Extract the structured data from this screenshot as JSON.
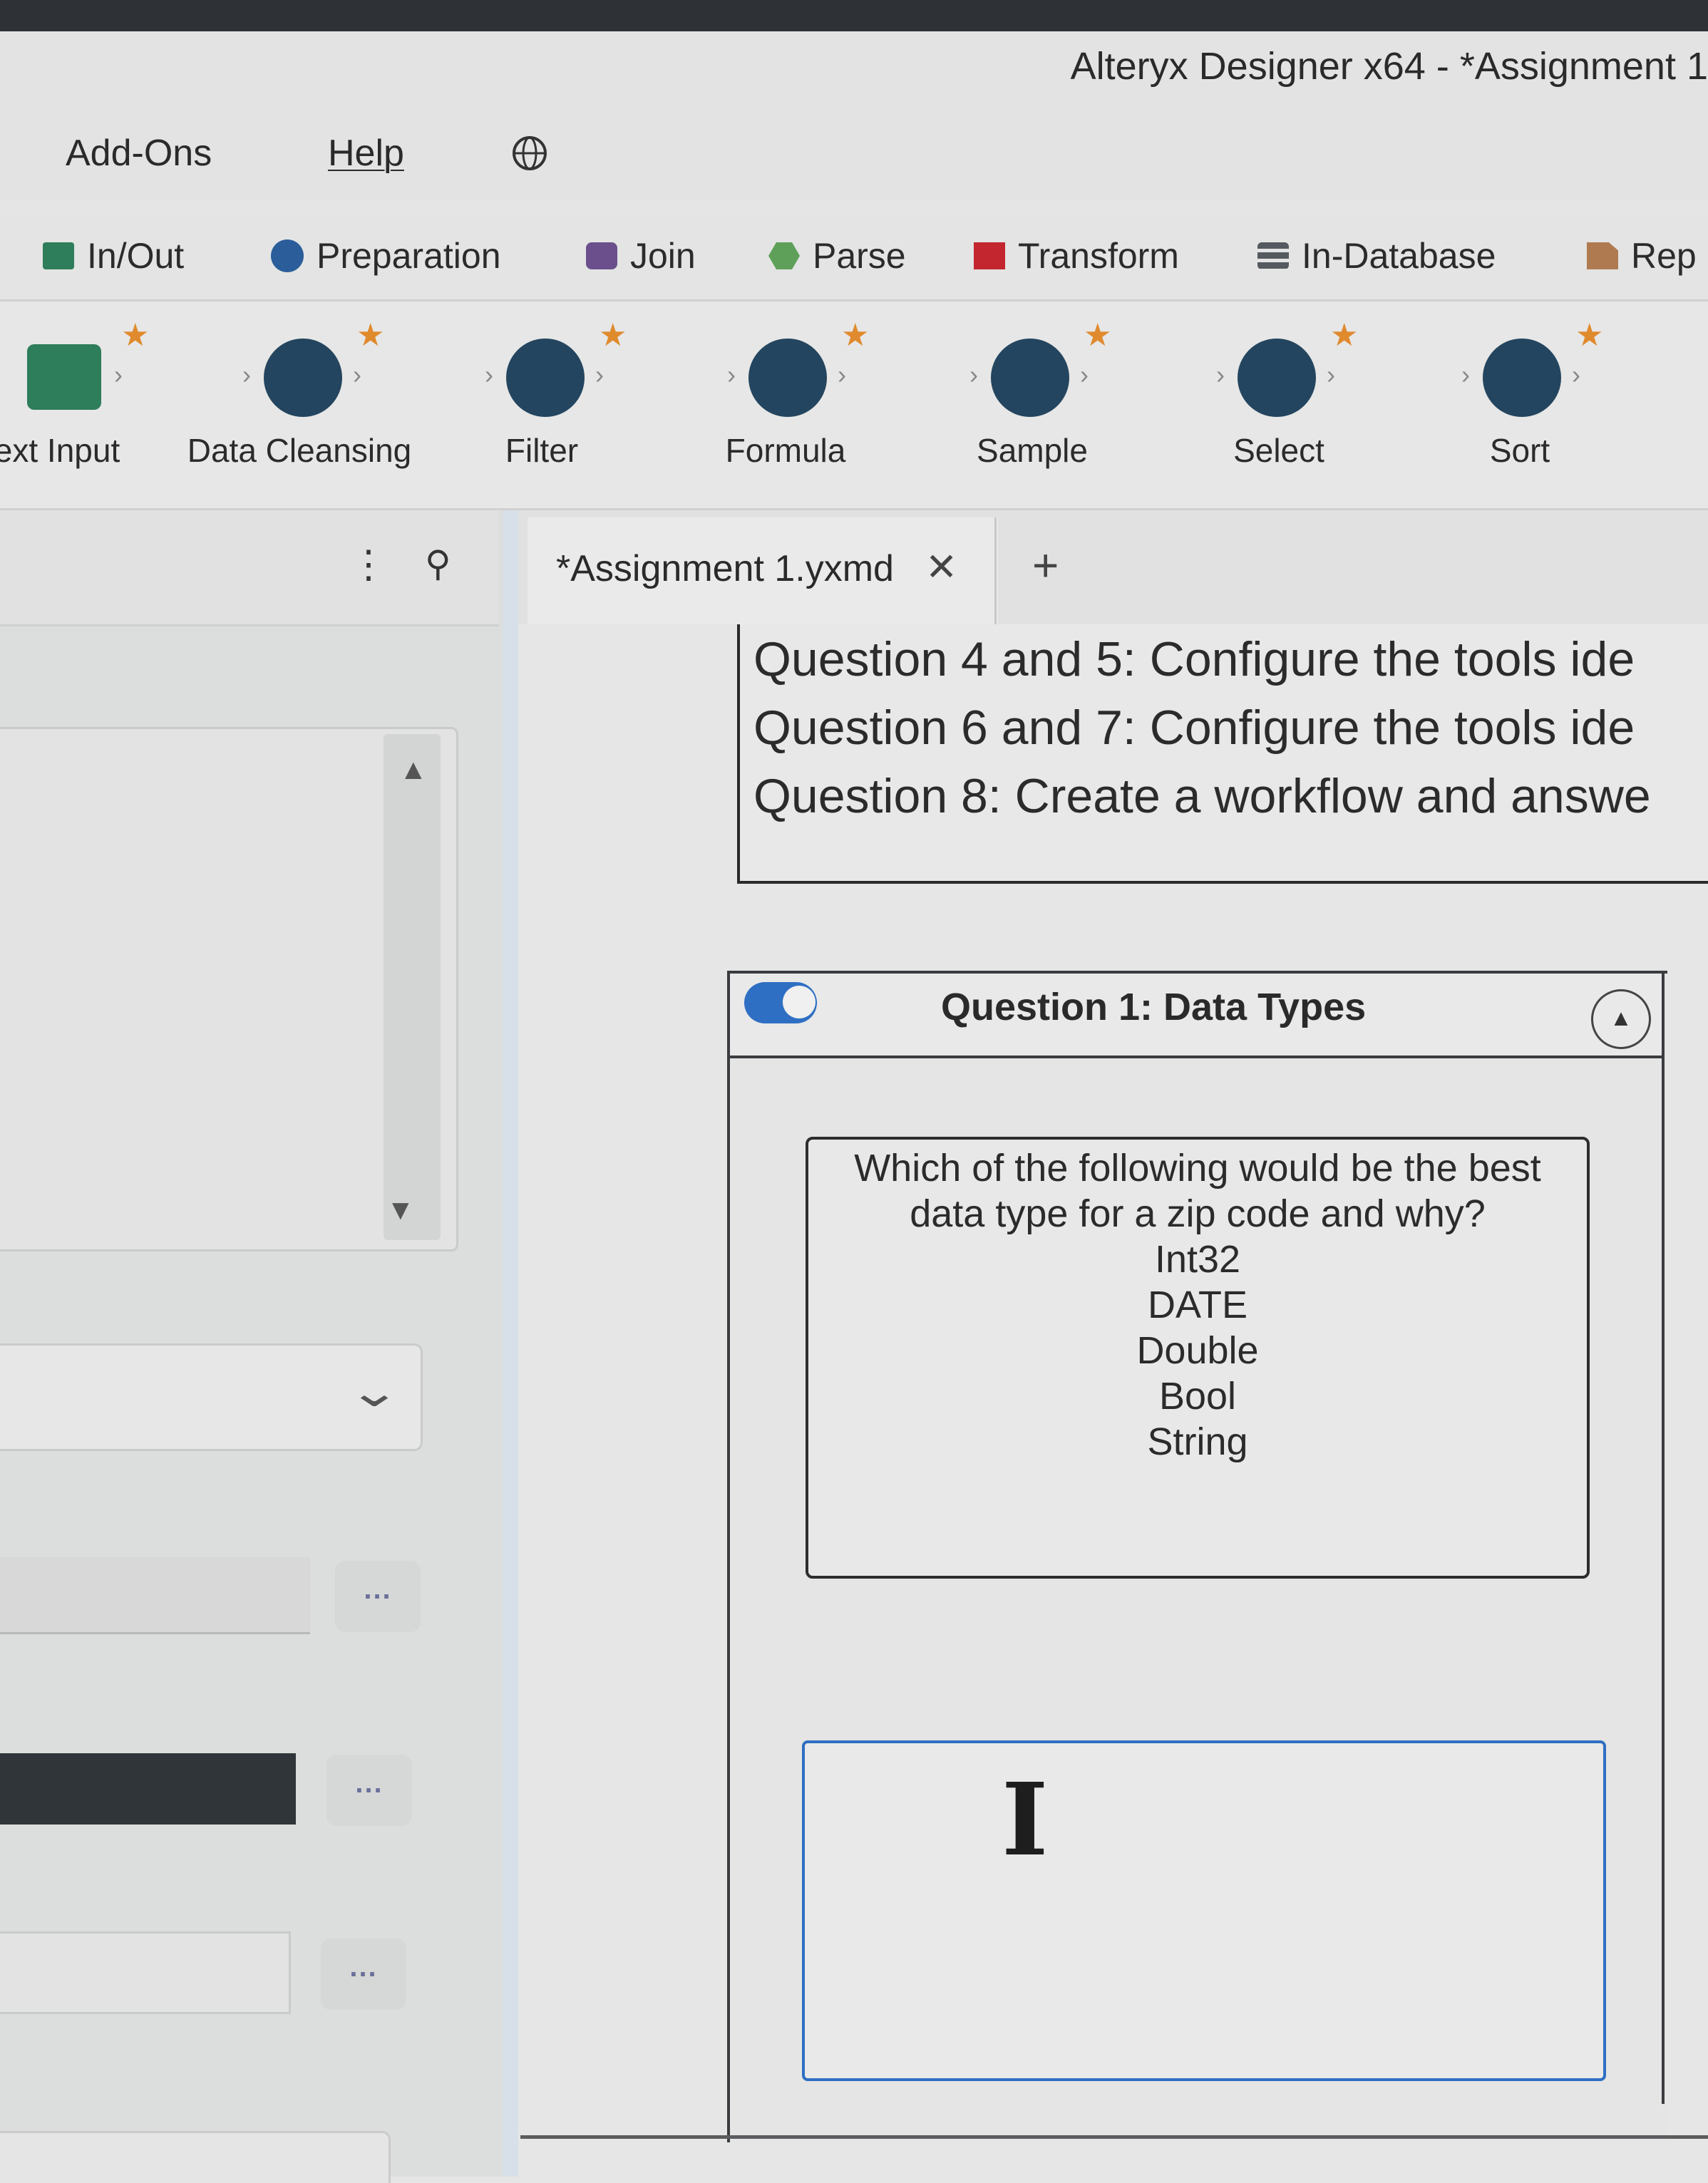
{
  "window": {
    "title": "Alteryx Designer x64 - *Assignment 1"
  },
  "menu": {
    "items": [
      "Add-Ons",
      "Help"
    ],
    "globe_icon": "globe-icon"
  },
  "categories": [
    {
      "label": "In/Out",
      "color": "#2e7d5b"
    },
    {
      "label": "Preparation",
      "color": "#2a5d9a"
    },
    {
      "label": "Join",
      "color": "#6a4f8c"
    },
    {
      "label": "Parse",
      "color": "#5ea05a"
    },
    {
      "label": "Transform",
      "color": "#c3262e"
    },
    {
      "label": "In-Database",
      "color": "#555a60"
    },
    {
      "label": "Rep",
      "color": "#b07a50"
    }
  ],
  "tools": [
    {
      "label": "ext Input",
      "icon": "book-icon"
    },
    {
      "label": "Data Cleansing",
      "icon": "data-cleansing-icon"
    },
    {
      "label": "Filter",
      "icon": "filter-icon"
    },
    {
      "label": "Formula",
      "icon": "formula-icon"
    },
    {
      "label": "Sample",
      "icon": "sample-icon"
    },
    {
      "label": "Select",
      "icon": "select-icon"
    },
    {
      "label": "Sort",
      "icon": "sort-icon"
    }
  ],
  "panel": {
    "kebab": "⋮",
    "pin": "⚲"
  },
  "tabs": {
    "active_label": "*Assignment 1.yxmd",
    "close_glyph": "✕",
    "add_glyph": "+"
  },
  "comment": {
    "lines": [
      "Question 4 and 5: Configure the tools ide",
      "Question 6 and 7: Configure the tools ide",
      "Question 8: Create a workflow and answe"
    ]
  },
  "container": {
    "title": "Question 1: Data Types",
    "toggle_on": true
  },
  "question": {
    "prompt_line1": "Which of the following would be the best",
    "prompt_line2": "data type for a zip code and why?",
    "options": [
      "Int32",
      "DATE",
      "Double",
      "Bool",
      "String"
    ]
  },
  "answer": {
    "value": ""
  },
  "ellipsis": "..."
}
